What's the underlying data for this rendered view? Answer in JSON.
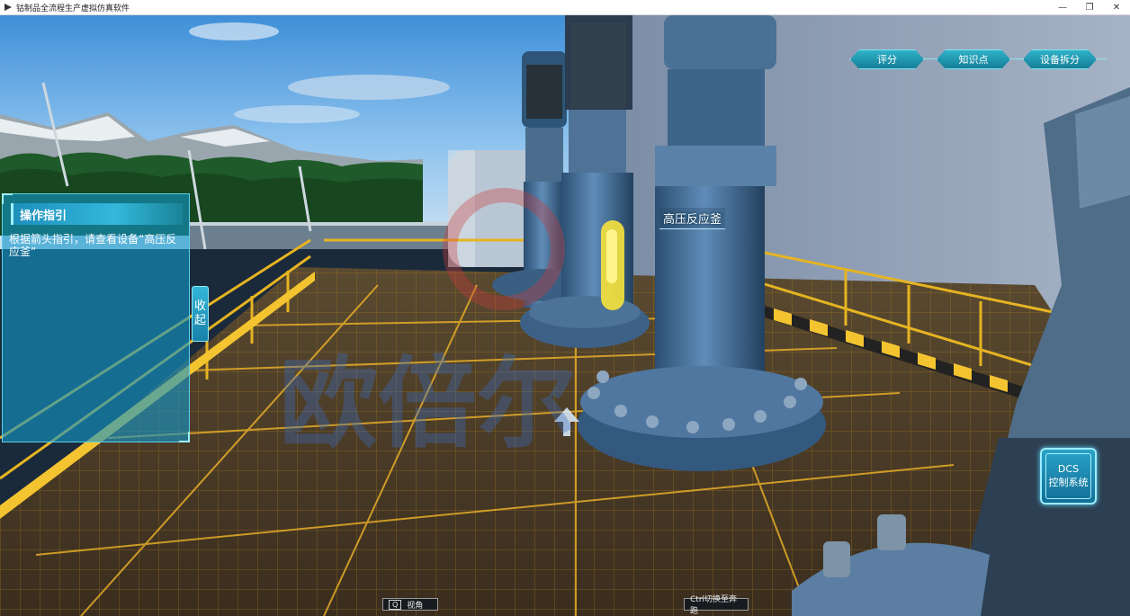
{
  "window": {
    "title": "钴制品全流程生产虚拟仿真软件",
    "min_symbol": "—",
    "restore_symbol": "❐",
    "close_symbol": "✕"
  },
  "nav": {
    "items": [
      {
        "label": "评分"
      },
      {
        "label": "知识点"
      },
      {
        "label": "设备拆分"
      }
    ],
    "accent": "#2fb2c8"
  },
  "guide": {
    "title": "操作指引",
    "instruction": "根据箭头指引，请查看设备“高压反应釜”",
    "collapse_label_1": "收",
    "collapse_label_2": "起"
  },
  "scene": {
    "equipment_tag": "高压反应釜",
    "watermark": "欧倍尔"
  },
  "dcs": {
    "line1": "DCS",
    "line2": "控制系统"
  },
  "hints": {
    "view_key": "Q",
    "view_label": "视角",
    "switch_label": "Ctrl切换至奔跑"
  },
  "colors": {
    "panel": "#1496c8",
    "grating": "#c79122",
    "equipment": "#3f6f9c"
  }
}
